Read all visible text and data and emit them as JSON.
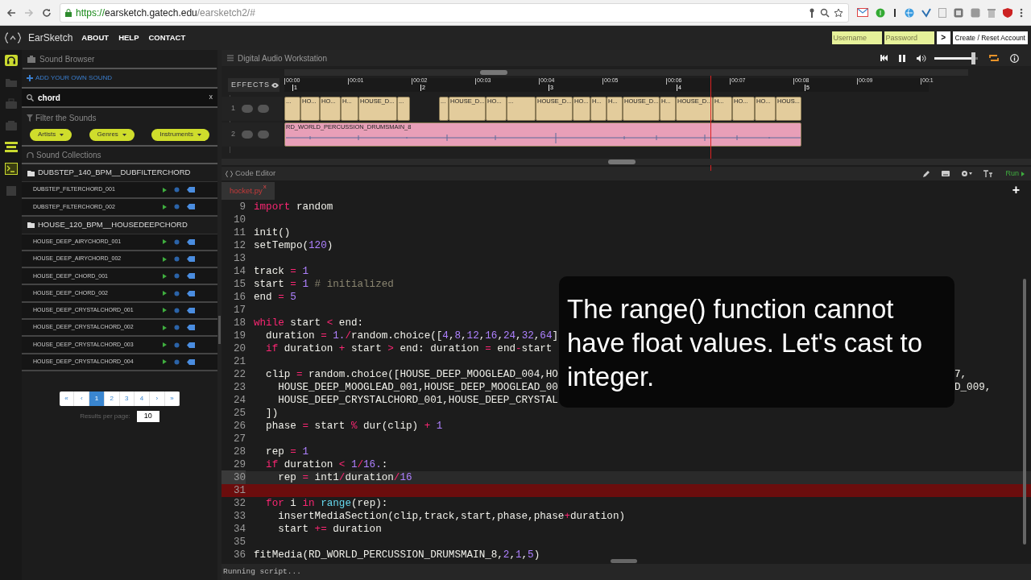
{
  "browser": {
    "url": {
      "scheme": "https://",
      "host": "earsketch.gatech.edu",
      "path": "/earsketch2/#"
    }
  },
  "app": {
    "brand": "EarSketch",
    "nav": [
      "ABOUT",
      "HELP",
      "CONTACT"
    ],
    "login": {
      "username_placeholder": "Username",
      "password_placeholder": "Password",
      "go": ">",
      "create": "Create / Reset Account"
    }
  },
  "rail": [
    {
      "kind": "sounds",
      "selected": true
    },
    {
      "kind": "scripts",
      "selected": false
    },
    {
      "kind": "share",
      "selected": false
    },
    {
      "kind": "curriculum",
      "selected": false
    },
    {
      "kind": "daw",
      "selected": true
    },
    {
      "kind": "editor",
      "selected": true
    },
    {
      "kind": "misc",
      "selected": false
    }
  ],
  "sound_browser": {
    "title": "Sound Browser",
    "add": "ADD YOUR OWN SOUND",
    "search": {
      "value": "chord",
      "clear": "x"
    },
    "filter_title": "Filter the Sounds",
    "filters": [
      "Artists",
      "Genres",
      "Instruments"
    ],
    "collections_title": "Sound Collections",
    "folders": [
      {
        "name": "DUBSTEP_140_BPM__DUBFILTERCHORD",
        "sounds": [
          "DUBSTEP_FILTERCHORD_001",
          "DUBSTEP_FILTERCHORD_002"
        ]
      },
      {
        "name": "HOUSE_120_BPM__HOUSEDEEPCHORD",
        "sounds": [
          "HOUSE_DEEP_AIRYCHORD_001",
          "HOUSE_DEEP_AIRYCHORD_002",
          "HOUSE_DEEP_CHORD_001",
          "HOUSE_DEEP_CHORD_002",
          "HOUSE_DEEP_CRYSTALCHORD_001",
          "HOUSE_DEEP_CRYSTALCHORD_002",
          "HOUSE_DEEP_CRYSTALCHORD_003",
          "HOUSE_DEEP_CRYSTALCHORD_004"
        ]
      }
    ],
    "pagination": [
      {
        "label": "«",
        "selected": false
      },
      {
        "label": "‹",
        "selected": false
      },
      {
        "label": "1",
        "selected": true
      },
      {
        "label": "2",
        "selected": false
      },
      {
        "label": "3",
        "selected": false
      },
      {
        "label": "4",
        "selected": false
      },
      {
        "label": "›",
        "selected": false
      },
      {
        "label": "»",
        "selected": false
      }
    ],
    "results_label": "Results per page:",
    "results_value": "10"
  },
  "daw": {
    "title": "Digital Audio Workstation",
    "volume": {
      "level": 0.95
    },
    "effects": "EFFECTS",
    "times": [
      "00:00",
      "00:01",
      "00:02",
      "00:03",
      "00:04",
      "00:05",
      "00:06",
      "00:07",
      "00:08",
      "00:09",
      "00:1"
    ],
    "measures": [
      "1",
      "2",
      "3",
      "4",
      "5"
    ],
    "tracks": [
      {
        "number": "1",
        "color": "#e3cc9c",
        "clips": [
          {
            "label": "..."
          },
          {
            "label": "HO..."
          },
          {
            "label": "HO..."
          },
          {
            "label": "H..."
          },
          {
            "label": "HOUSE_D..."
          },
          {
            "label": "..."
          },
          {
            "label": "..."
          },
          {
            "label": "HOUSE_D..."
          },
          {
            "label": "HO..."
          },
          {
            "label": "..."
          },
          {
            "label": "HOUSE_D..."
          },
          {
            "label": "HO..."
          },
          {
            "label": "H..."
          },
          {
            "label": "H..."
          },
          {
            "label": "HOUSE_D..."
          },
          {
            "label": "H..."
          },
          {
            "label": "HOUSE_D..."
          },
          {
            "label": "H..."
          },
          {
            "label": "HO..."
          },
          {
            "label": "HO..."
          },
          {
            "label": "HOUS..."
          }
        ]
      },
      {
        "number": "2",
        "color": "#e89fb8",
        "clips": [
          {
            "label": "RD_WORLD_PERCUSSION_DRUMSMAIN_8"
          }
        ]
      }
    ]
  },
  "editor": {
    "title": "Code Editor",
    "run": "Run",
    "tab": {
      "name": "hocket.py",
      "close": "x"
    },
    "add": "+",
    "lines": [
      {
        "number": "9",
        "current": false,
        "error": false,
        "tokens": [
          {
            "kind": "keyword",
            "text": "import"
          },
          {
            "kind": "plain",
            "text": " random"
          }
        ]
      },
      {
        "number": "10",
        "current": false,
        "error": false
      },
      {
        "number": "11",
        "current": false,
        "error": false,
        "tokens": [
          {
            "kind": "plain",
            "text": "init()"
          }
        ]
      },
      {
        "number": "12",
        "current": false,
        "error": false,
        "tokens": [
          {
            "kind": "plain",
            "text": "setTempo("
          },
          {
            "kind": "number",
            "text": "120"
          },
          {
            "kind": "plain",
            "text": ")"
          }
        ]
      },
      {
        "number": "13",
        "current": false,
        "error": false
      },
      {
        "number": "14",
        "current": false,
        "error": false,
        "tokens": [
          {
            "kind": "plain",
            "text": "track "
          },
          {
            "kind": "operator",
            "text": "="
          },
          {
            "kind": "number",
            "text": " 1"
          }
        ]
      },
      {
        "number": "15",
        "current": false,
        "error": false,
        "tokens": [
          {
            "kind": "plain",
            "text": "start "
          },
          {
            "kind": "operator",
            "text": "="
          },
          {
            "kind": "number",
            "text": " 1"
          },
          {
            "kind": "comment",
            "text": " # initialized"
          }
        ]
      },
      {
        "number": "16",
        "current": false,
        "error": false,
        "tokens": [
          {
            "kind": "plain",
            "text": "end "
          },
          {
            "kind": "operator",
            "text": "="
          },
          {
            "kind": "number",
            "text": " 5"
          }
        ]
      },
      {
        "number": "17",
        "current": false,
        "error": false
      },
      {
        "number": "18",
        "current": false,
        "error": false,
        "tokens": [
          {
            "kind": "keyword",
            "text": "while"
          },
          {
            "kind": "plain",
            "text": " start "
          },
          {
            "kind": "operator",
            "text": "<"
          },
          {
            "kind": "plain",
            "text": " end:"
          }
        ]
      },
      {
        "number": "19",
        "current": false,
        "error": false,
        "tokens": [
          {
            "kind": "plain",
            "text": "  duration "
          },
          {
            "kind": "operator",
            "text": "="
          },
          {
            "kind": "number",
            "text": " 1."
          },
          {
            "kind": "operator",
            "text": "/"
          },
          {
            "kind": "plain",
            "text": "random.choice(["
          },
          {
            "kind": "number",
            "text": "4"
          },
          {
            "kind": "plain",
            "text": ","
          },
          {
            "kind": "number",
            "text": "8"
          },
          {
            "kind": "plain",
            "text": ","
          },
          {
            "kind": "number",
            "text": "12"
          },
          {
            "kind": "plain",
            "text": ","
          },
          {
            "kind": "number",
            "text": "16"
          },
          {
            "kind": "plain",
            "text": ","
          },
          {
            "kind": "number",
            "text": "24"
          },
          {
            "kind": "plain",
            "text": ","
          },
          {
            "kind": "number",
            "text": "32"
          },
          {
            "kind": "plain",
            "text": ","
          },
          {
            "kind": "number",
            "text": "64"
          },
          {
            "kind": "plain",
            "text": "]"
          }
        ]
      },
      {
        "number": "20",
        "current": false,
        "error": false,
        "tokens": [
          {
            "kind": "keyword",
            "text": "  if"
          },
          {
            "kind": "plain",
            "text": " duration "
          },
          {
            "kind": "operator",
            "text": "+"
          },
          {
            "kind": "plain",
            "text": " start "
          },
          {
            "kind": "operator",
            "text": ">"
          },
          {
            "kind": "plain",
            "text": " end: duration "
          },
          {
            "kind": "operator",
            "text": "="
          },
          {
            "kind": "plain",
            "text": " end"
          },
          {
            "kind": "operator",
            "text": "-"
          },
          {
            "kind": "plain",
            "text": "start"
          }
        ]
      },
      {
        "number": "21",
        "current": false,
        "error": false
      },
      {
        "number": "22",
        "current": false,
        "error": false,
        "tokens": [
          {
            "kind": "plain",
            "text": "  clip "
          },
          {
            "kind": "operator",
            "text": "="
          },
          {
            "kind": "plain",
            "text": " random.choice([HOUSE_DEEP_MOOGLEAD_004,HO"
          }
        ],
        "tail": "7,"
      },
      {
        "number": "23",
        "current": false,
        "error": false,
        "tokens": [
          {
            "kind": "plain",
            "text": "    HOUSE_DEEP_MOOGLEAD_001,HOUSE_DEEP_MOOGLEAD_00"
          }
        ],
        "tail": "D_009,"
      },
      {
        "number": "24",
        "current": false,
        "error": false,
        "tokens": [
          {
            "kind": "plain",
            "text": "    HOUSE_DEEP_CRYSTALCHORD_001,HOUSE_DEEP_CRYSTAL"
          }
        ]
      },
      {
        "number": "25",
        "current": false,
        "error": false,
        "tokens": [
          {
            "kind": "plain",
            "text": "  ])"
          }
        ]
      },
      {
        "number": "26",
        "current": false,
        "error": false,
        "tokens": [
          {
            "kind": "plain",
            "text": "  phase "
          },
          {
            "kind": "operator",
            "text": "="
          },
          {
            "kind": "plain",
            "text": " start "
          },
          {
            "kind": "operator",
            "text": "%"
          },
          {
            "kind": "plain",
            "text": " dur(clip) "
          },
          {
            "kind": "operator",
            "text": "+"
          },
          {
            "kind": "number",
            "text": " 1"
          }
        ]
      },
      {
        "number": "27",
        "current": false,
        "error": false
      },
      {
        "number": "28",
        "current": false,
        "error": false,
        "tokens": [
          {
            "kind": "plain",
            "text": "  rep "
          },
          {
            "kind": "operator",
            "text": "="
          },
          {
            "kind": "number",
            "text": " 1"
          }
        ]
      },
      {
        "number": "29",
        "current": false,
        "error": false,
        "tokens": [
          {
            "kind": "keyword",
            "text": "  if"
          },
          {
            "kind": "plain",
            "text": " duration "
          },
          {
            "kind": "operator",
            "text": "<"
          },
          {
            "kind": "number",
            "text": " 1"
          },
          {
            "kind": "operator",
            "text": "/"
          },
          {
            "kind": "number",
            "text": "16."
          },
          {
            "kind": "plain",
            "text": ":"
          }
        ]
      },
      {
        "number": "30",
        "current": true,
        "error": false,
        "tokens": [
          {
            "kind": "plain",
            "text": "    rep "
          },
          {
            "kind": "operator",
            "text": "="
          },
          {
            "kind": "plain",
            "text": " int1"
          },
          {
            "kind": "operator",
            "text": "/"
          },
          {
            "kind": "plain",
            "text": "duration"
          },
          {
            "kind": "operator",
            "text": "/"
          },
          {
            "kind": "number",
            "text": "16"
          }
        ]
      },
      {
        "number": "31",
        "current": false,
        "error": true
      },
      {
        "number": "32",
        "current": false,
        "error": false,
        "tokens": [
          {
            "kind": "keyword",
            "text": "  for"
          },
          {
            "kind": "plain",
            "text": " i "
          },
          {
            "kind": "keyword",
            "text": "in"
          },
          {
            "kind": "builtin",
            "text": " range"
          },
          {
            "kind": "plain",
            "text": "(rep):"
          }
        ]
      },
      {
        "number": "33",
        "current": false,
        "error": false,
        "tokens": [
          {
            "kind": "plain",
            "text": "    insertMediaSection(clip,track,start,phase,phase"
          },
          {
            "kind": "operator",
            "text": "+"
          },
          {
            "kind": "plain",
            "text": "duration)"
          }
        ]
      },
      {
        "number": "34",
        "current": false,
        "error": false,
        "tokens": [
          {
            "kind": "plain",
            "text": "    start "
          },
          {
            "kind": "operator",
            "text": "+="
          },
          {
            "kind": "plain",
            "text": " duration"
          }
        ]
      },
      {
        "number": "35",
        "current": false,
        "error": false
      },
      {
        "number": "36",
        "current": false,
        "error": false,
        "tokens": [
          {
            "kind": "plain",
            "text": "fitMedia(RD_WORLD_PERCUSSION_DRUMSMAIN_8,"
          },
          {
            "kind": "number",
            "text": "2"
          },
          {
            "kind": "plain",
            "text": ","
          },
          {
            "kind": "number",
            "text": "1"
          },
          {
            "kind": "plain",
            "text": ","
          },
          {
            "kind": "number",
            "text": "5"
          },
          {
            "kind": "plain",
            "text": ")"
          }
        ]
      }
    ],
    "caption": "The range() function cannot have float values. Let's cast to integer.",
    "status": "Running script..."
  }
}
